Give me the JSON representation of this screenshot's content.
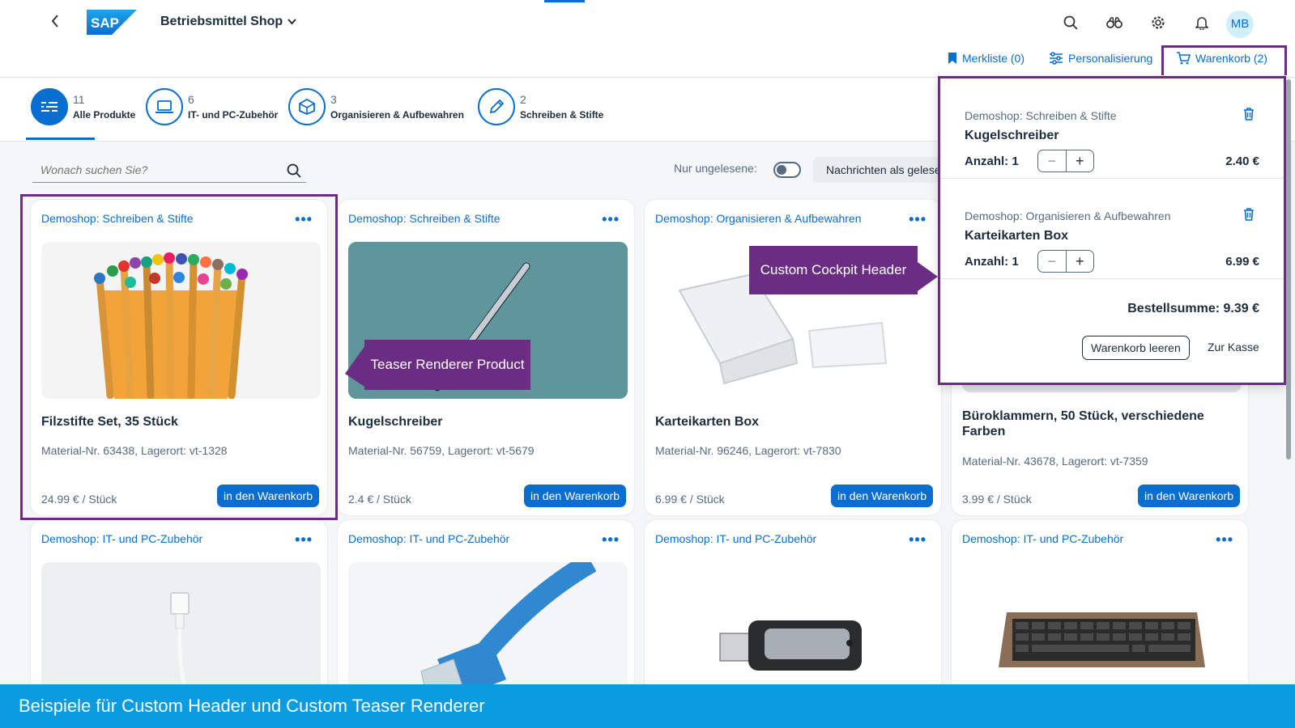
{
  "shell": {
    "title": "Betriebsmittel Shop",
    "avatar": "MB",
    "logo_text": "SAP",
    "icons": [
      "search-icon",
      "binoculars-icon",
      "gear-icon",
      "bell-icon"
    ]
  },
  "actions": {
    "merkliste": "Merkliste (0)",
    "personalisierung": "Personalisierung",
    "warenkorb": "Warenkorb (2)"
  },
  "tabs": [
    {
      "count": "11",
      "label": "Alle Produkte",
      "icon": "list-icon"
    },
    {
      "count": "6",
      "label": "IT- und PC-Zubehör",
      "icon": "laptop-icon"
    },
    {
      "count": "3",
      "label": "Organisieren & Aufbewahren",
      "icon": "box-icon"
    },
    {
      "count": "2",
      "label": "Schreiben & Stifte",
      "icon": "pencil-icon"
    }
  ],
  "search": {
    "placeholder": "Wonach suchen Sie?"
  },
  "filter": {
    "label": "Nur ungelesene:",
    "mark_read": "Nachrichten als gelesen markieren"
  },
  "cards": [
    {
      "shop": "Demoshop: Schreiben & Stifte",
      "title": "Filzstifte Set, 35 Stück",
      "meta": "Material-Nr. 63438, Lagerort: vt-1328",
      "price": "24.99 € / Stück",
      "button": "in den Warenkorb"
    },
    {
      "shop": "Demoshop: Schreiben & Stifte",
      "title": "Kugelschreiber",
      "meta": "Material-Nr. 56759, Lagerort: vt-5679",
      "price": "2.4 € / Stück",
      "button": "in den Warenkorb"
    },
    {
      "shop": "Demoshop: Organisieren & Aufbewahren",
      "title": "Karteikarten Box",
      "meta": "Material-Nr. 96246, Lagerort: vt-7830",
      "price": "6.99 € / Stück",
      "button": "in den Warenkorb"
    },
    {
      "shop": "",
      "title": "Büroklammern, 50 Stück, verschiedene Farben",
      "meta": "Material-Nr. 43678, Lagerort: vt-7359",
      "price": "3.99 € / Stück",
      "button": "in den Warenkorb"
    },
    {
      "shop": "Demoshop: IT- und PC-Zubehör"
    },
    {
      "shop": "Demoshop: IT- und PC-Zubehör"
    },
    {
      "shop": "Demoshop: IT- und PC-Zubehör"
    },
    {
      "shop": "Demoshop: IT- und PC-Zubehör"
    }
  ],
  "cart": {
    "items": [
      {
        "shop": "Demoshop: Schreiben & Stifte",
        "name": "Kugelschreiber",
        "qty": "Anzahl: 1",
        "amount": "2.40 €"
      },
      {
        "shop": "Demoshop: Organisieren & Aufbewahren",
        "name": "Karteikarten Box",
        "qty": "Anzahl: 1",
        "amount": "6.99 €"
      }
    ],
    "sum": "Bestellsumme: 9.39 €",
    "clear": "Warenkorb leeren",
    "checkout": "Zur Kasse"
  },
  "callouts": {
    "teaser": "Teaser Renderer Product",
    "cockpit": "Custom Cockpit Header"
  },
  "banner": "Beispiele für Custom Header und Custom Teaser Renderer",
  "colors": {
    "accent": "#0a6ed1",
    "annotation": "#6b2d83",
    "banner": "#0a9be0"
  }
}
